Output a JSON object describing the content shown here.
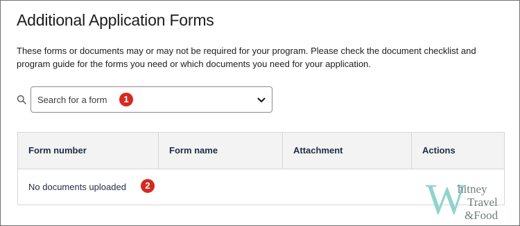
{
  "page": {
    "title": "Additional Application Forms",
    "description": "These forms or documents may or may not be required for your program. Please check the document checklist and program guide for the forms you need or which documents you need for your application."
  },
  "search": {
    "placeholder": "Search for a form",
    "icon": "search-icon",
    "dropdown_icon": "chevron-down-icon"
  },
  "markers": [
    "1",
    "2"
  ],
  "table": {
    "headers": [
      "Form number",
      "Form name",
      "Attachment",
      "Actions"
    ],
    "empty_message": "No documents uploaded"
  },
  "watermark": {
    "letter": "W",
    "line1": "hitney",
    "line2": "Travel",
    "line3": "&Food"
  },
  "colors": {
    "marker": "#d42a20",
    "header_bg": "#f3f3f3",
    "header_text": "#1f2b45",
    "watermark": "#86cfc8"
  }
}
